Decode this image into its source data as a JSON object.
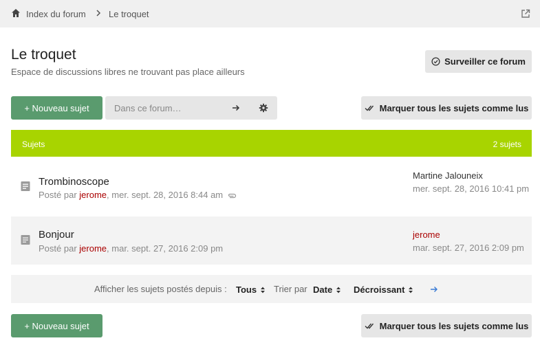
{
  "breadcrumb": {
    "home_icon": "home-icon",
    "items": [
      "Index du forum",
      "Le troquet"
    ],
    "separator_icon": "chevron-right-icon",
    "external_icon": "external-link-icon"
  },
  "forum": {
    "title": "Le troquet",
    "description": "Espace de discussions libres ne trouvant pas place ailleurs"
  },
  "actions": {
    "watch_label": "Surveiller ce forum",
    "new_topic_label": "+ Nouveau sujet",
    "mark_read_label": "Marquer tous les sujets comme lus",
    "search_placeholder": "Dans ce forum…"
  },
  "topics_header": {
    "label": "Sujets",
    "count": "2 sujets",
    "color": "#a8d400"
  },
  "topics": [
    {
      "title": "Trombinoscope",
      "posted_prefix": "Posté par",
      "author": "jerome",
      "date": ", mer. sept. 28, 2016 8:44 am",
      "has_attachment": true,
      "last_user": "Martine Jalouneix",
      "last_date": "mer. sept. 28, 2016 10:41 pm"
    },
    {
      "title": "Bonjour",
      "posted_prefix": "Posté par",
      "author": "jerome",
      "date": ", mar. sept. 27, 2016 2:09 pm",
      "has_attachment": false,
      "last_user": "jerome",
      "last_date": "mar. sept. 27, 2016 2:09 pm"
    }
  ],
  "filters": {
    "show_label": "Afficher les sujets postés depuis :",
    "show_value": "Tous",
    "sort_label": "Trier par",
    "sort_value": "Date",
    "order_value": "Décroissant"
  },
  "colors": {
    "accent_green": "#5a9b6e",
    "user_red": "#aa0000"
  }
}
